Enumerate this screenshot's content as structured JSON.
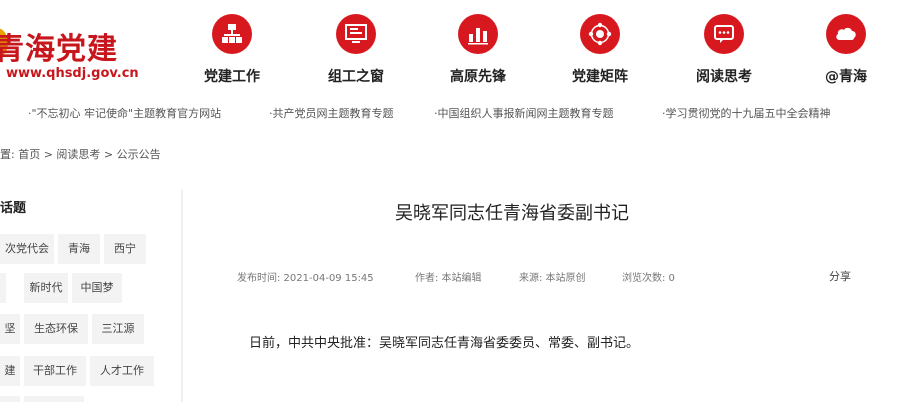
{
  "header": {
    "logo_title": "青海党建",
    "logo_url": "www.qhsdj.gov.cn",
    "nav": [
      {
        "label": "党建工作",
        "icon": "org-chart-icon"
      },
      {
        "label": "组工之窗",
        "icon": "screen-icon"
      },
      {
        "label": "高原先锋",
        "icon": "bar-chart-icon"
      },
      {
        "label": "党建矩阵",
        "icon": "network-icon"
      },
      {
        "label": "阅读思考",
        "icon": "chat-icon"
      },
      {
        "label": "@青海",
        "icon": "cloud-icon"
      }
    ]
  },
  "links": [
    "·\"不忘初心 牢记使命\"主题教育官方网站",
    "·共产党员网主题教育专题",
    "·中国组织人事报新闻网主题教育专题",
    "·学习贯彻党的十九届五中全会精神"
  ],
  "breadcrumb": "置: 首页 > 阅读思考 > 公示公告",
  "sidebar": {
    "title": "话题",
    "tags": [
      "次党代会",
      "青海",
      "西宁",
      "新时代",
      "中国梦",
      "坚",
      "生态环保",
      "三江源",
      "建",
      "干部工作",
      "人才工作"
    ]
  },
  "article": {
    "title": "吴晓军同志任青海省委副书记",
    "meta": {
      "published": "发布时间: 2021-04-09 15:45",
      "author": "作者: 本站编辑",
      "source": "来源: 本站原创",
      "views": "浏览次数: 0"
    },
    "share_label": "分享",
    "body": "日前，中共中央批准：吴晓军同志任青海省委委员、常委、副书记。"
  },
  "colors": {
    "brand_red": "#d7191f",
    "logo_red": "#c8161d",
    "logo_gold": "#e8a200"
  }
}
